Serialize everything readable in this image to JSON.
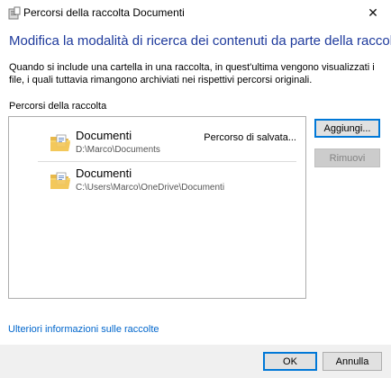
{
  "window": {
    "title": "Percorsi della raccolta Documenti",
    "close_glyph": "✕"
  },
  "heading": "Modifica la modalità di ricerca dei contenuti da parte della raccolta",
  "description": "Quando si include una cartella in una raccolta, in quest'ultima vengono visualizzati i file, i quali tuttavia rimangono archiviati nei rispettivi percorsi originali.",
  "section_label": "Percorsi della raccolta",
  "locations": [
    {
      "name": "Documenti",
      "path": "D:\\Marco\\Documents",
      "badge": "Percorso di salvata..."
    },
    {
      "name": "Documenti",
      "path": "C:\\Users\\Marco\\OneDrive\\Documenti",
      "badge": ""
    }
  ],
  "buttons": {
    "add": "Aggiungi...",
    "remove": "Rimuovi",
    "ok": "OK",
    "cancel": "Annulla"
  },
  "more_info_link": "Ulteriori informazioni sulle raccolte",
  "colors": {
    "heading": "#1e3a9c",
    "link": "#0066cc",
    "accent": "#0078d7",
    "footer_bg": "#f0f0f0"
  }
}
